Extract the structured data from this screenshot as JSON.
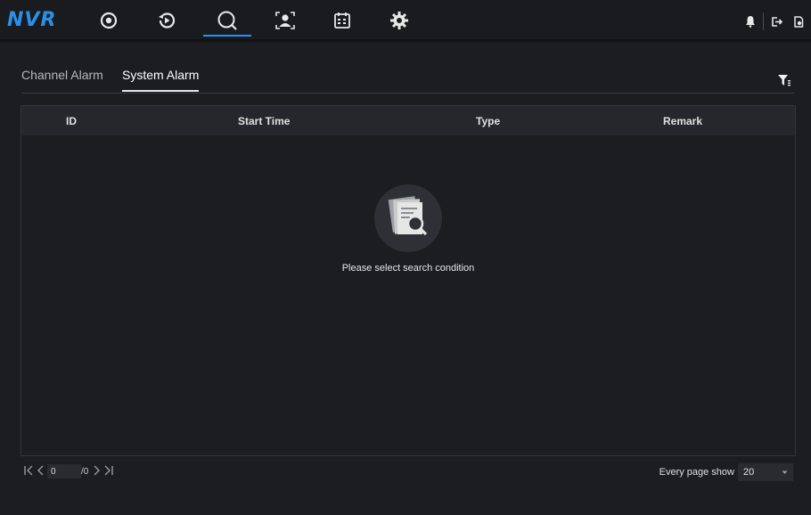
{
  "app": {
    "logo": "NVR"
  },
  "nav": [
    {
      "icon": "live-view-icon"
    },
    {
      "icon": "playback-icon"
    },
    {
      "icon": "search-icon",
      "active": true
    },
    {
      "icon": "face-recognition-icon"
    },
    {
      "icon": "schedule-icon"
    },
    {
      "icon": "settings-icon"
    }
  ],
  "header_icons": [
    "alarm-bell-icon",
    "logout-icon",
    "lock-icon"
  ],
  "tabs": {
    "channel_alarm": "Channel Alarm",
    "system_alarm": "System Alarm",
    "active": "System Alarm"
  },
  "table": {
    "columns": [
      "ID",
      "Start Time",
      "Type",
      "Remark"
    ],
    "rows": [],
    "empty_message": "Please select search condition"
  },
  "pagination": {
    "current_page": "0",
    "total": "/0",
    "page_size_label": "Every page show",
    "page_size": "20"
  },
  "colors": {
    "accent": "#2f8ef0",
    "background": "#1c1d21",
    "header": "#26272c"
  }
}
